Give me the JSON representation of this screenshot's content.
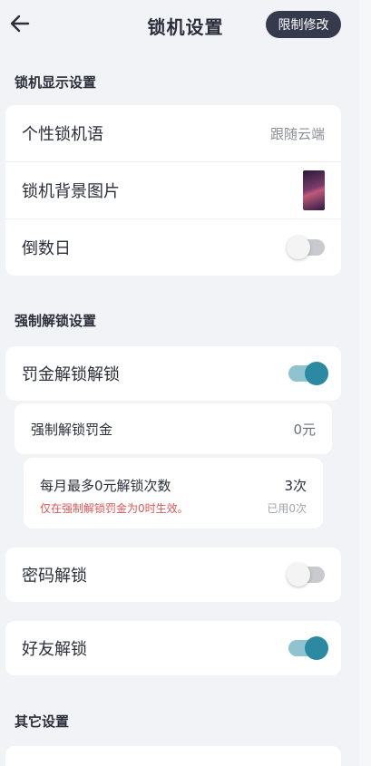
{
  "header": {
    "title": "锁机设置",
    "limit_button": "限制修改"
  },
  "sections": {
    "display": {
      "title": "锁机显示设置",
      "items": {
        "slogan_label": "个性锁机语",
        "slogan_value": "跟随云端",
        "bg_label": "锁机背景图片",
        "countdown_label": "倒数日",
        "countdown_on": false
      }
    },
    "force": {
      "title": "强制解锁设置",
      "fine_unlock_label": "罚金解锁解锁",
      "fine_unlock_on": true,
      "fine_amount_label": "强制解锁罚金",
      "fine_amount_value": "0元",
      "monthly_label": "每月最多0元解锁次数",
      "monthly_note": "仅在强制解锁罚金为0时生效。",
      "monthly_count": "3次",
      "monthly_used": "已用0次"
    },
    "password": {
      "label": "密码解锁",
      "on": false
    },
    "friend": {
      "label": "好友解锁",
      "on": true
    },
    "other": {
      "title": "其它设置"
    }
  }
}
